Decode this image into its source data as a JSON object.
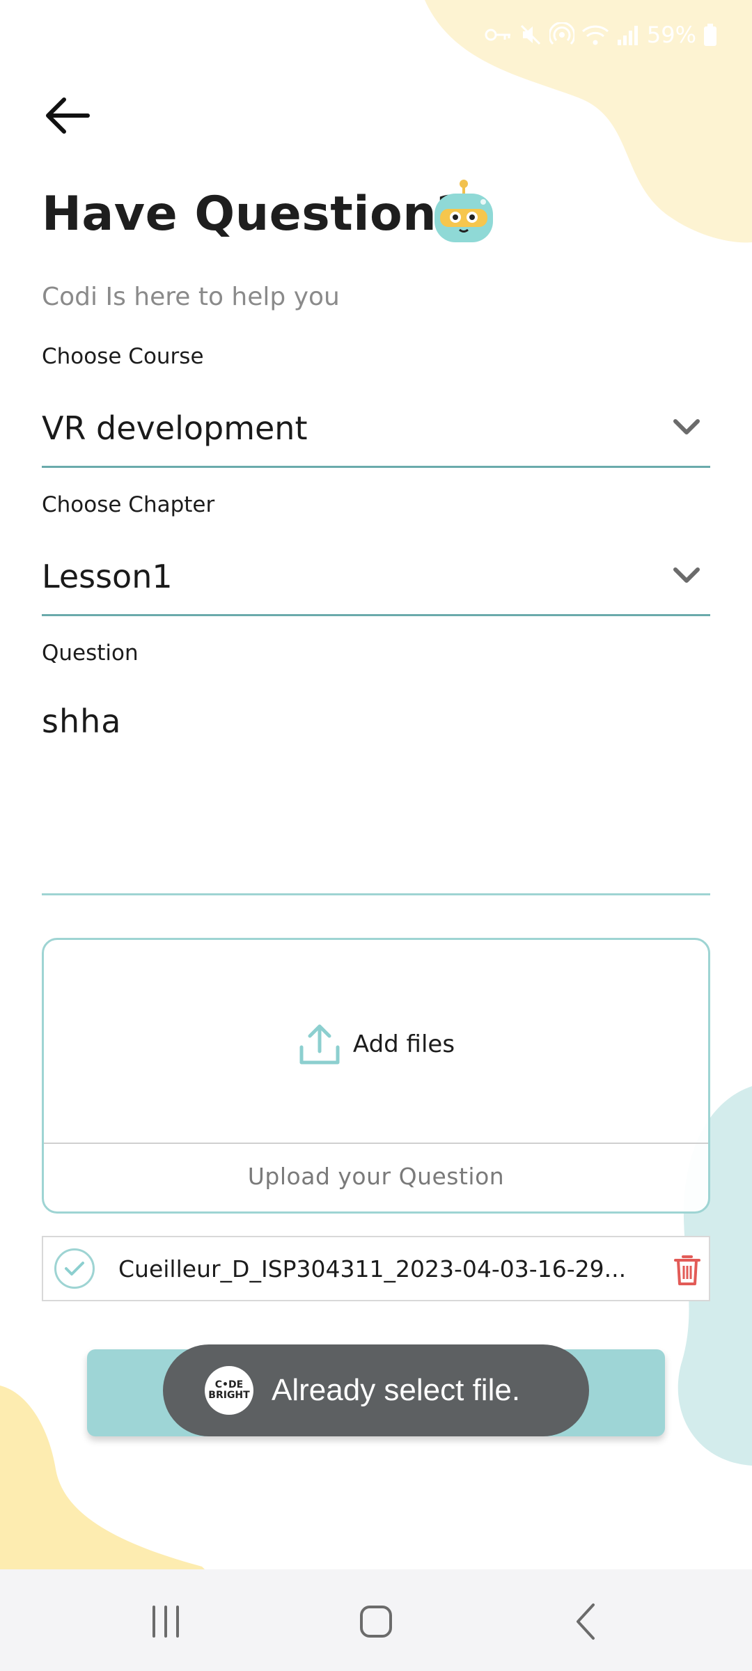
{
  "status_bar": {
    "battery": "59%"
  },
  "header": {
    "title": "Have Question?",
    "subtitle": "Codi Is here to help you"
  },
  "form": {
    "course_label": "Choose Course",
    "course_value": "VR development",
    "chapter_label": "Choose Chapter",
    "chapter_value": "Lesson1",
    "question_label": "Question",
    "question_value": "shha"
  },
  "upload": {
    "add_files_label": "Add files",
    "caption": "Upload your Question"
  },
  "file": {
    "name": "Cueilleur_D_ISP304311_2023-04-03-16-29..."
  },
  "toast": {
    "message": "Already select file.",
    "logo_line1": "C•DE",
    "logo_line2": "BRIGHT"
  },
  "colors": {
    "accent": "#9ed5d6",
    "underline": "#6aaaab",
    "delete": "#e25b57",
    "toast_bg": "#5d6062",
    "blob_yellow": "#fdf3d2",
    "blob_teal": "#d3ecec"
  },
  "icons": {
    "back": "arrow-left-icon",
    "dropdown": "chevron-down-icon",
    "upload": "upload-icon",
    "check": "check-circle-icon",
    "delete": "trash-icon"
  }
}
